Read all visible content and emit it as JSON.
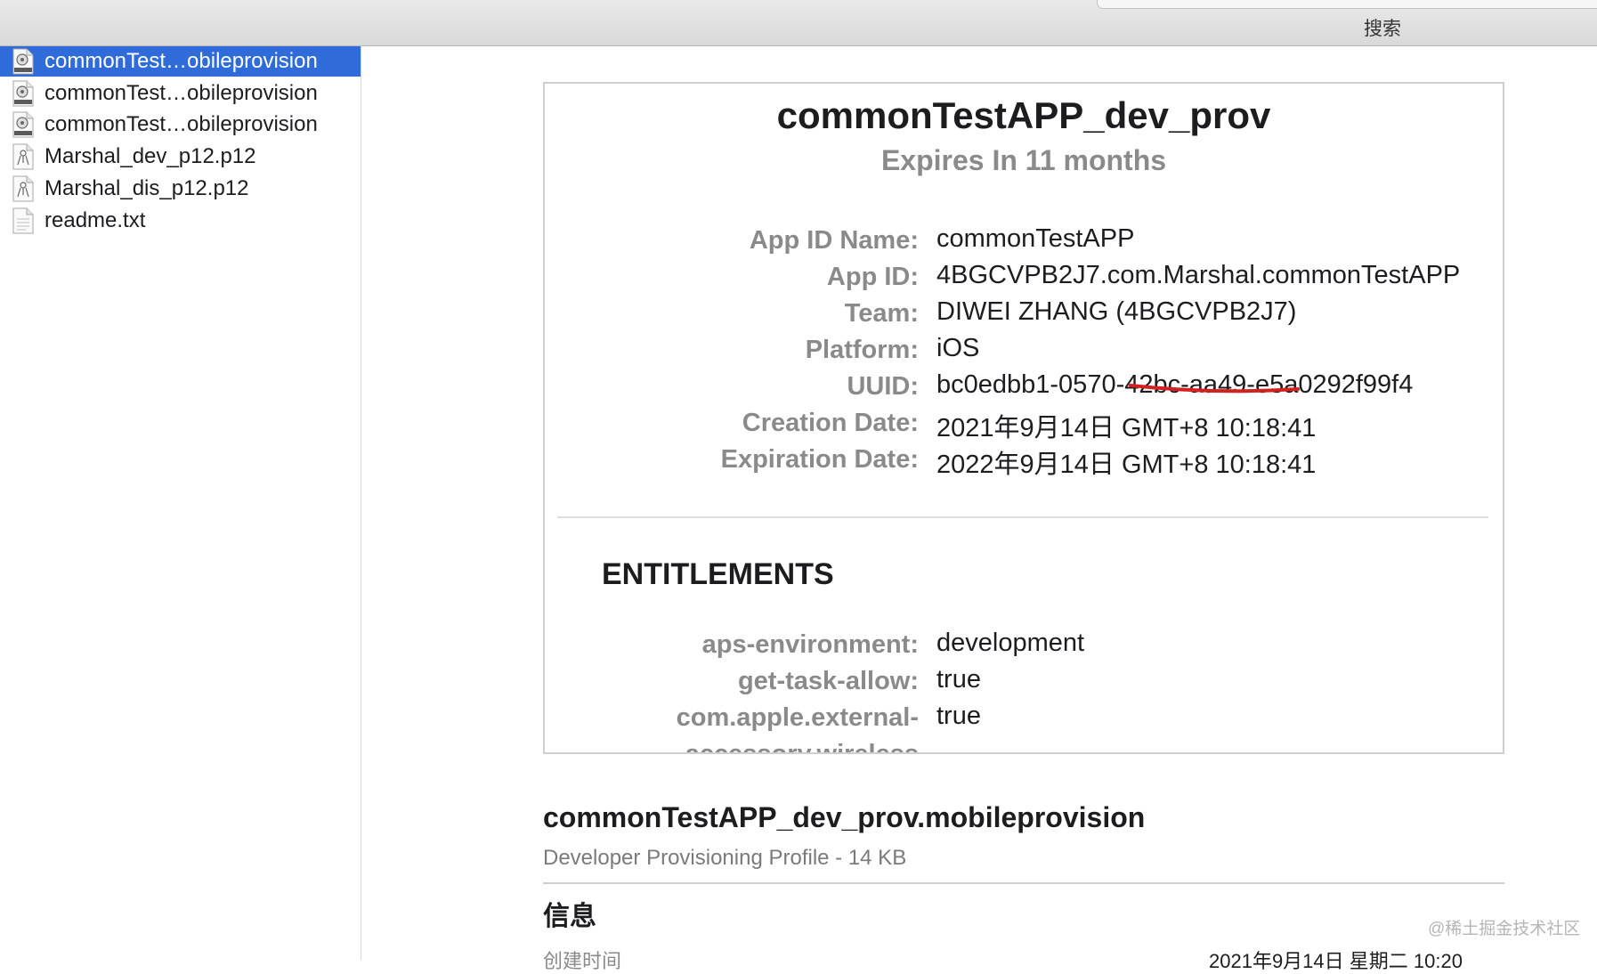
{
  "toolbar": {
    "search_label": "搜索"
  },
  "sidebar": {
    "files": [
      {
        "name": "commonTest…obileprovision",
        "icon": "provisioning-profile-icon",
        "selected": true
      },
      {
        "name": "commonTest…obileprovision",
        "icon": "provisioning-profile-icon",
        "selected": false
      },
      {
        "name": "commonTest…obileprovision",
        "icon": "provisioning-profile-icon",
        "selected": false
      },
      {
        "name": "Marshal_dev_p12.p12",
        "icon": "certificate-file-icon",
        "selected": false
      },
      {
        "name": "Marshal_dis_p12.p12",
        "icon": "certificate-file-icon",
        "selected": false
      },
      {
        "name": "readme.txt",
        "icon": "text-file-icon",
        "selected": false
      }
    ]
  },
  "preview": {
    "title": "commonTestAPP_dev_prov",
    "subtitle": "Expires In 11 months",
    "details": [
      {
        "label": "App ID Name:",
        "value": "commonTestAPP"
      },
      {
        "label": "App ID:",
        "value": "4BGCVPB2J7.com.Marshal.commonTestAPP"
      },
      {
        "label": "Team:",
        "value": "DIWEI ZHANG (4BGCVPB2J7)"
      },
      {
        "label": "Platform:",
        "value": "iOS"
      },
      {
        "label": "UUID:",
        "value": "bc0edbb1-0570-42bc-aa49-e5a0292f99f4"
      },
      {
        "label": "Creation Date:",
        "value": "2021年9月14日 GMT+8 10:18:41"
      },
      {
        "label": "Expiration Date:",
        "value": "2022年9月14日 GMT+8 10:18:41"
      }
    ],
    "entitlements_heading": "ENTITLEMENTS",
    "entitlements": [
      {
        "label": "aps-environment:",
        "value": "development"
      },
      {
        "label": "get-task-allow:",
        "value": "true"
      },
      {
        "label": "com.apple.external-",
        "value": "true"
      },
      {
        "label": "accessory.wireless",
        "value": ""
      }
    ]
  },
  "file_info": {
    "filename": "commonTestAPP_dev_prov.mobileprovision",
    "kind": "Developer Provisioning Profile - 14 KB",
    "section_heading": "信息",
    "created_label": "创建时间",
    "created_value": "2021年9月14日 星期二 10:20"
  },
  "watermark": "@稀土掘金技术社区",
  "colors": {
    "selection": "#2f6bd9",
    "annotation_underline": "#d62020",
    "label_gray": "#8a8a8a"
  }
}
